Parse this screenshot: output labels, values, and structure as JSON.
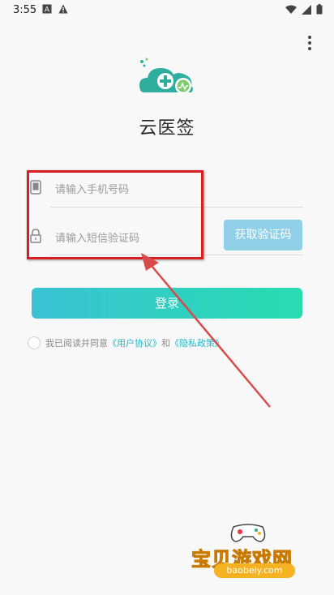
{
  "status_bar": {
    "time": "3:55",
    "left_icons": [
      "a-notification-icon",
      "alert-icon"
    ],
    "right_icons": [
      "wifi-icon",
      "signal-icon",
      "battery-icon"
    ]
  },
  "app": {
    "name": "云医签",
    "logo_icon": "cloud-plus-logo-icon"
  },
  "form": {
    "phone_placeholder": "请输入手机号码",
    "code_placeholder": "请输入短信验证码",
    "get_code_label": "获取验证码",
    "login_label": "登录"
  },
  "agreement": {
    "prefix": "我已阅读并同意",
    "user_agreement": "《用户协议》",
    "and": "和",
    "privacy_policy": "《隐私政策》"
  },
  "watermark": {
    "title": "宝贝游戏网",
    "url": "baobeiy.com"
  },
  "colors": {
    "accent_start": "#38c2d3",
    "accent_end": "#29dcb0",
    "code_button": "#8fcfe8",
    "annotation": "#d81e1e",
    "link": "#26b6c8"
  }
}
